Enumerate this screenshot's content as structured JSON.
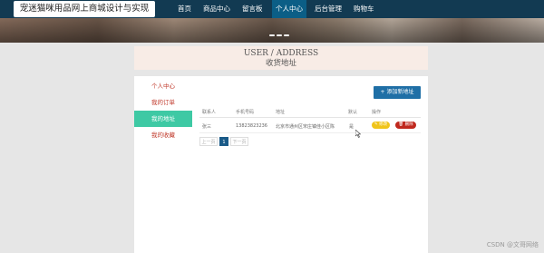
{
  "header": {
    "site_title": "宠迷猫咪用品网上商城设计与实现",
    "nav": [
      "首页",
      "商品中心",
      "留言板",
      "个人中心",
      "后台管理",
      "购物车"
    ],
    "active_nav": "个人中心"
  },
  "section": {
    "title_en": "USER / ADDRESS",
    "title_cn": "收货地址"
  },
  "sidebar": {
    "items": [
      "个人中心",
      "我的订单",
      "我的地址",
      "我的收藏"
    ],
    "active": "我的地址"
  },
  "actions": {
    "add_address": "+ 添加新地址"
  },
  "table": {
    "headers": [
      "联系人",
      "手机号码",
      "地址",
      "默认",
      "操作"
    ],
    "rows": [
      {
        "contact": "张三",
        "phone": "13823823236",
        "address": "北京市通州区宋庄镇佳小区陈",
        "default": "是",
        "edit": "✎ 修改",
        "delete": "🗑 删除"
      }
    ]
  },
  "pagination": {
    "prev": "上一页",
    "current": "1",
    "next": "下一页"
  },
  "watermark": "CSDN @文哥网络",
  "colors": {
    "nav_bg": "#123a52",
    "active_side": "#3ec9a4",
    "primary_btn": "#1f6fa6",
    "edit_btn": "#f0c419",
    "delete_btn": "#c0281e"
  }
}
